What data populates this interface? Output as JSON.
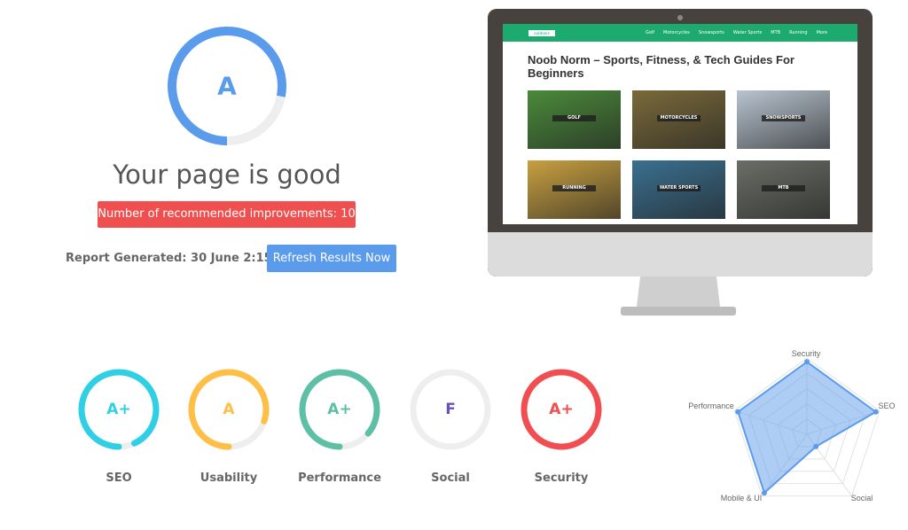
{
  "overall": {
    "grade": "A",
    "score": 0.78,
    "color": "#5b9bec",
    "headline": "Your page is good",
    "improvements": "Number of recommended improvements: 10",
    "report": "Report Generated: 30 June 2:15PM",
    "refresh_label": "Refresh Results Now"
  },
  "categories": [
    {
      "label": "SEO",
      "grade": "A+",
      "score": 0.93,
      "color": "#2fcfe6"
    },
    {
      "label": "Usability",
      "grade": "A",
      "score": 0.8,
      "color": "#ffbe45"
    },
    {
      "label": "Performance",
      "grade": "A+",
      "score": 0.86,
      "color": "#5cbfa6"
    },
    {
      "label": "Social",
      "grade": "F",
      "score": 0,
      "color": "#6a50b8"
    },
    {
      "label": "Security",
      "grade": "A+",
      "score": 1.0,
      "color": "#f04e50"
    }
  ],
  "preview": {
    "logo": "outdoors",
    "nav": [
      "Golf",
      "Motorcycles",
      "Snowsports",
      "Water Sports",
      "MTB",
      "Running",
      "More"
    ],
    "title": "Noob Norm – Sports, Fitness, & Tech Guides For Beginners",
    "tiles": [
      {
        "label": "GOLF",
        "color": "#4a8a3a"
      },
      {
        "label": "MOTORCYCLES",
        "color": "#7a6a3a"
      },
      {
        "label": "SNOWSPORTS",
        "color": "#b8c4d0"
      },
      {
        "label": "RUNNING",
        "color": "#c8a040"
      },
      {
        "label": "WATER SPORTS",
        "color": "#3a7090"
      },
      {
        "label": "MTB",
        "color": "#6a6e66"
      }
    ]
  },
  "chart_data": {
    "type": "radar",
    "axes": [
      "Security",
      "SEO",
      "Social",
      "Mobile & UI",
      "Performance"
    ],
    "values": [
      95,
      95,
      20,
      95,
      95
    ],
    "range": [
      0,
      100
    ],
    "rings": 5,
    "color": "#5b9bec"
  }
}
